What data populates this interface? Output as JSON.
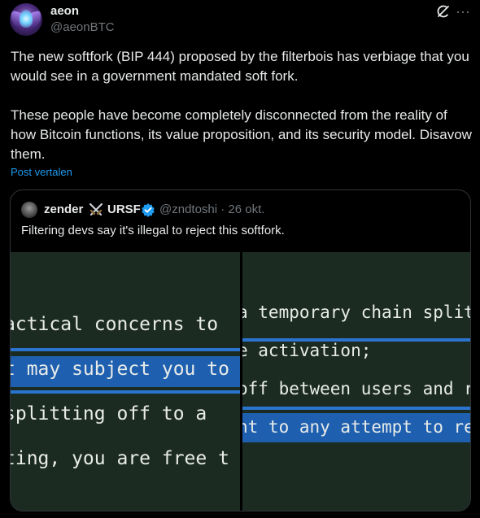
{
  "author": {
    "display_name": "aeon",
    "handle": "@aeonBTC",
    "avatar_icon": "avatar-icon"
  },
  "post": {
    "text": "The new softfork (BIP 444) proposed by the filterbois has verbiage that you would see in a government mandated soft fork.\n\nThese people have become completely disconnected from the reality of how Bitcoin functions, its value proposition, and its security model. Disavow them.",
    "translate_label": "Post vertalen"
  },
  "quote": {
    "name_part1": "zender",
    "name_emoji": "crossed-swords-icon",
    "name_part2": "URSF",
    "handle_date": "@zndtoshi · 26 okt.",
    "text": "Filtering devs say it's illegal to reject this softfork.",
    "image": {
      "left_lines": [
        "actical concerns to",
        "t may subject you to",
        "splitting off to a",
        "ting, you are free t"
      ],
      "right_lines": [
        "a temporary chain split",
        "e activation;",
        "off between users and r",
        "nt to any attempt to re"
      ]
    }
  },
  "colors": {
    "accent": "#1d9bf0",
    "muted": "#71767b",
    "highlight": "#1e5fb0",
    "image_bg": "#1c2b22"
  }
}
